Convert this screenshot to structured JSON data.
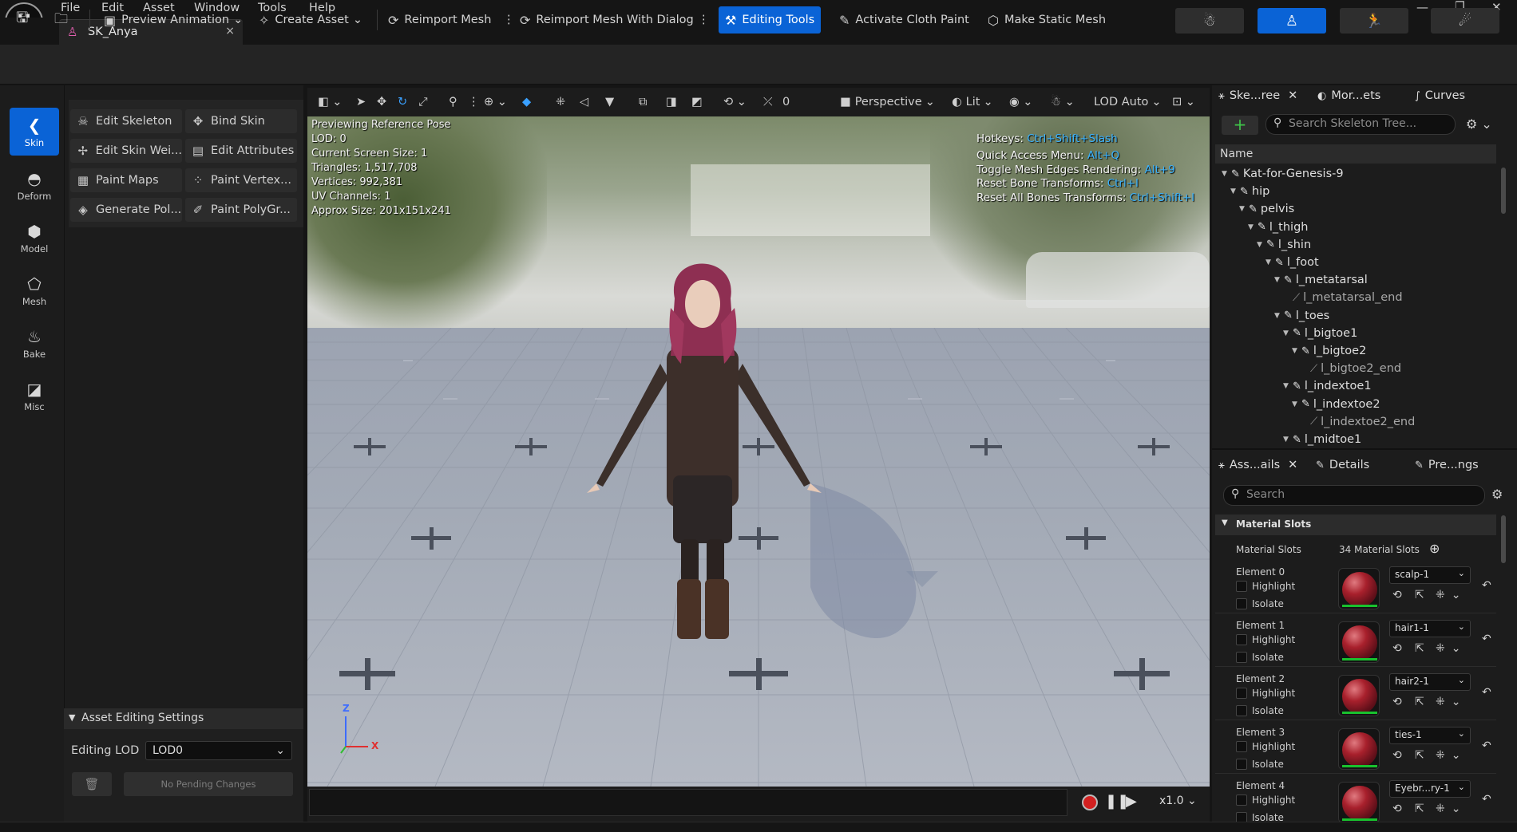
{
  "menu": {
    "items": [
      "File",
      "Edit",
      "Asset",
      "Window",
      "Tools",
      "Help"
    ]
  },
  "doc_tab": {
    "title": "SK_Anya",
    "close": "×"
  },
  "toolbar": {
    "preview_animation": "Preview Animation",
    "create_asset": "Create Asset",
    "reimport_mesh": "Reimport Mesh",
    "reimport_mesh_dialog": "Reimport Mesh With Dialog",
    "editing_tools": "Editing Tools",
    "activate_cloth_paint": "Activate Cloth Paint",
    "make_static_mesh": "Make Static Mesh"
  },
  "rail": {
    "items": [
      {
        "label": "Skin",
        "icon": "skin-icon",
        "active": true
      },
      {
        "label": "Deform",
        "icon": "deform-icon",
        "active": false
      },
      {
        "label": "Model",
        "icon": "model-icon",
        "active": false
      },
      {
        "label": "Mesh",
        "icon": "mesh-icon",
        "active": false
      },
      {
        "label": "Bake",
        "icon": "bake-icon",
        "active": false
      },
      {
        "label": "Misc",
        "icon": "misc-icon",
        "active": false
      }
    ]
  },
  "tools": {
    "items": [
      {
        "label": "Edit Skeleton",
        "icon": "skeleton-icon"
      },
      {
        "label": "Bind Skin",
        "icon": "bind-skin-icon"
      },
      {
        "label": "Edit Skin Wei...",
        "icon": "skin-weights-icon"
      },
      {
        "label": "Edit Attributes",
        "icon": "attributes-icon"
      },
      {
        "label": "Paint Maps",
        "icon": "paint-maps-icon"
      },
      {
        "label": "Paint Vertex...",
        "icon": "paint-vertex-icon"
      },
      {
        "label": "Generate Pol...",
        "icon": "generate-poly-icon"
      },
      {
        "label": "Paint PolyGr...",
        "icon": "paint-polygroups-icon"
      }
    ]
  },
  "asset_editing": {
    "title": "Asset Editing Settings",
    "lod_label": "Editing LOD",
    "lod_value": "LOD0",
    "pending": "No Pending Changes"
  },
  "viewport_toolbar": {
    "fov": "0",
    "perspective": "Perspective",
    "lit": "Lit",
    "lod": "LOD Auto"
  },
  "viewport_stats": {
    "lines": [
      "Previewing Reference Pose",
      "LOD: 0",
      "Current Screen Size: 1",
      "Triangles: 1,517,708",
      "Vertices: 992,381",
      "UV Channels: 1",
      "Approx Size: 201x151x241"
    ]
  },
  "hotkeys": {
    "lines": [
      {
        "label": "Hotkeys: ",
        "key": "Ctrl+Shift+Slash"
      },
      {
        "label": "Quick Access Menu: ",
        "key": "Alt+Q"
      },
      {
        "label": "Toggle Mesh Edges Rendering: ",
        "key": "Alt+9"
      },
      {
        "label": "Reset Bone Transforms: ",
        "key": "Ctrl+I"
      },
      {
        "label": "Reset All Bones Transforms: ",
        "key": "Ctrl+Shift+I"
      }
    ]
  },
  "axis": {
    "z": "Z",
    "x": "X"
  },
  "playback": {
    "speed": "x1.0"
  },
  "skeleton_panel": {
    "tabs": [
      "Ske...ree",
      "Mor...ets",
      "Curves"
    ],
    "search_placeholder": "Search Skeleton Tree...",
    "col_name": "Name",
    "bones": [
      {
        "name": "Kat-for-Genesis-9",
        "depth": 0,
        "end": false
      },
      {
        "name": "hip",
        "depth": 1,
        "end": false
      },
      {
        "name": "pelvis",
        "depth": 2,
        "end": false
      },
      {
        "name": "l_thigh",
        "depth": 3,
        "end": false
      },
      {
        "name": "l_shin",
        "depth": 4,
        "end": false
      },
      {
        "name": "l_foot",
        "depth": 5,
        "end": false
      },
      {
        "name": "l_metatarsal",
        "depth": 6,
        "end": false
      },
      {
        "name": "l_metatarsal_end",
        "depth": 7,
        "end": true
      },
      {
        "name": "l_toes",
        "depth": 6,
        "end": false
      },
      {
        "name": "l_bigtoe1",
        "depth": 7,
        "end": false
      },
      {
        "name": "l_bigtoe2",
        "depth": 8,
        "end": false
      },
      {
        "name": "l_bigtoe2_end",
        "depth": 9,
        "end": true
      },
      {
        "name": "l_indextoe1",
        "depth": 7,
        "end": false
      },
      {
        "name": "l_indextoe2",
        "depth": 8,
        "end": false
      },
      {
        "name": "l_indextoe2_end",
        "depth": 9,
        "end": true
      },
      {
        "name": "l_midtoe1",
        "depth": 7,
        "end": false
      }
    ]
  },
  "details_panel": {
    "tabs": [
      "Ass...ails",
      "Details",
      "Pre...ngs"
    ],
    "search_placeholder": "Search",
    "section": "Material Slots",
    "slots_label": "Material Slots",
    "slots_count": "34 Material Slots",
    "highlight": "Highlight",
    "isolate": "Isolate",
    "elements": [
      {
        "label": "Element 0",
        "material": "scalp-1"
      },
      {
        "label": "Element 1",
        "material": "hair1-1"
      },
      {
        "label": "Element 2",
        "material": "hair2-1"
      },
      {
        "label": "Element 3",
        "material": "ties-1"
      },
      {
        "label": "Element 4",
        "material": "Eyebr...ry-1"
      }
    ]
  }
}
